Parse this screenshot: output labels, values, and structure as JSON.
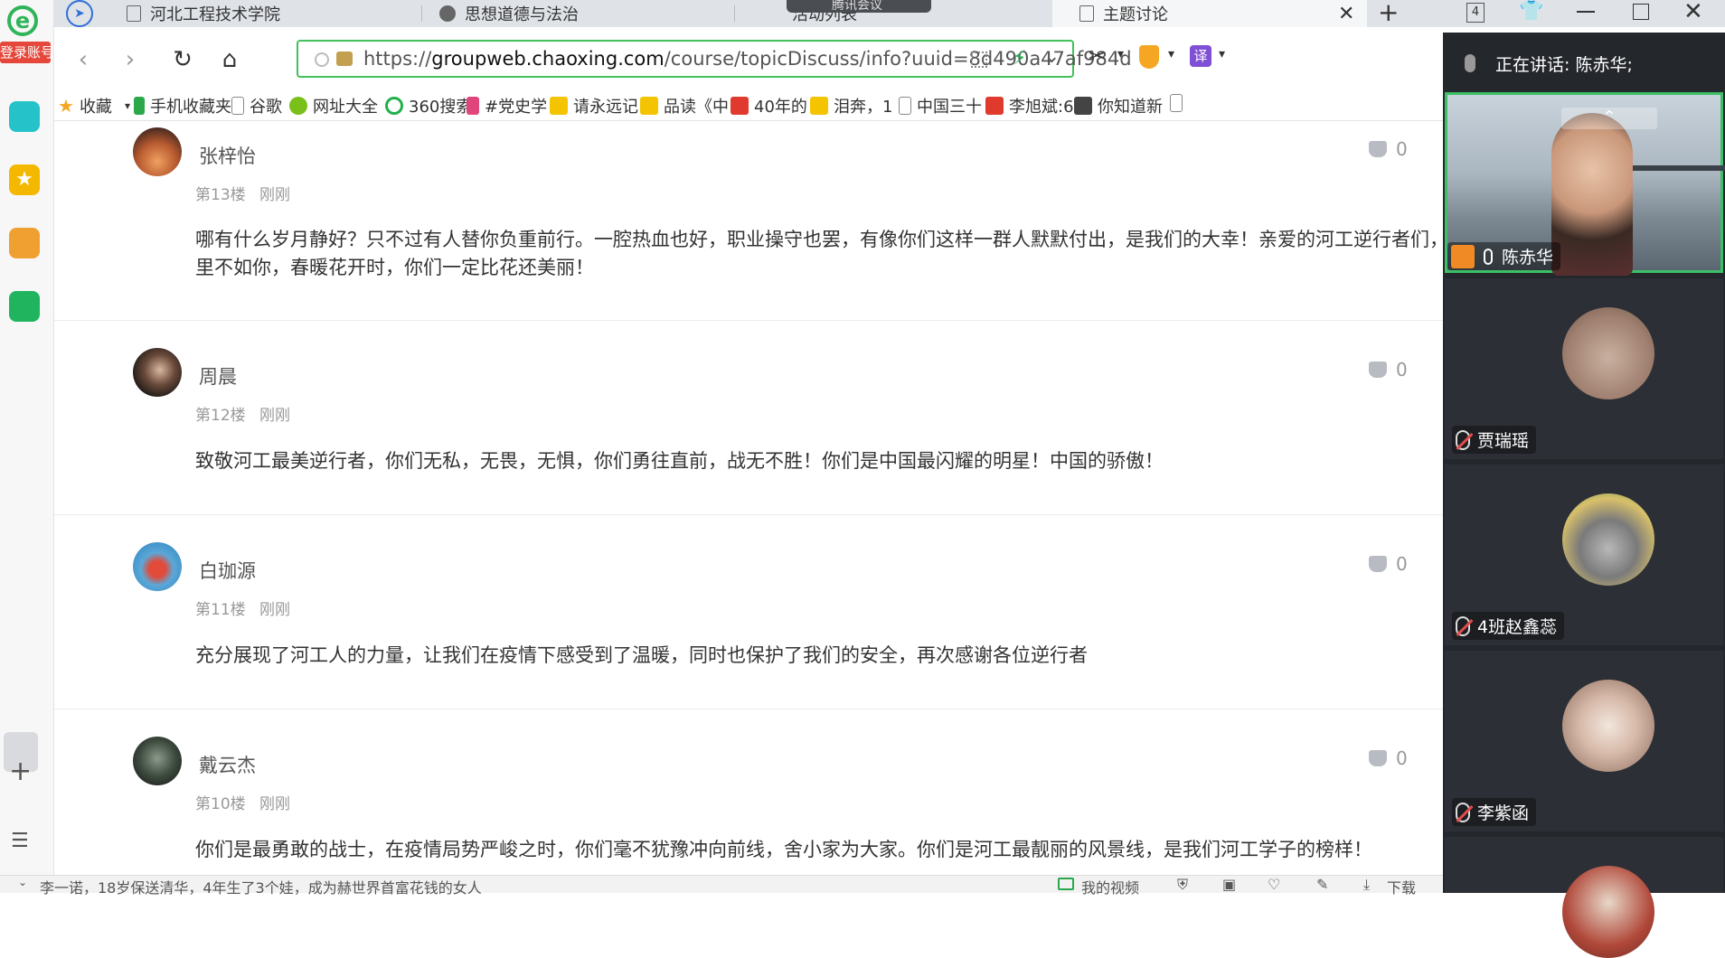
{
  "tabs": [
    {
      "label": "河北工程技术学院"
    },
    {
      "label": "思想道德与法治"
    },
    {
      "label": "活动列表"
    },
    {
      "label": "主题讨论"
    }
  ],
  "meeting_overlay_label": "腾讯会议",
  "tab_count": "4",
  "address": {
    "scheme": "https://",
    "host": "groupweb.chaoxing.com",
    "path": "/course/topicDiscuss/info?uuid=8d490a47af984d"
  },
  "bookmarks": [
    {
      "label": "收藏",
      "color": "#f5a623"
    },
    {
      "label": "手机收藏夹",
      "color": "#2aa84a"
    },
    {
      "label": "谷歌",
      "color": "#888888"
    },
    {
      "label": "网址大全",
      "color": "#7bbf1a"
    },
    {
      "label": "360搜索",
      "color": "#21b04b"
    },
    {
      "label": "#党史学",
      "color": "#e0457b"
    },
    {
      "label": "请永远记",
      "color": "#f5c400"
    },
    {
      "label": "品读《中",
      "color": "#f5c400"
    },
    {
      "label": "40年的",
      "color": "#e03a2e"
    },
    {
      "label": "泪奔，1",
      "color": "#f5c400"
    },
    {
      "label": "中国三十",
      "color": "#888888"
    },
    {
      "label": "李旭斌:6",
      "color": "#e03a2e"
    },
    {
      "label": "你知道新",
      "color": "#444444"
    }
  ],
  "sidebar": {
    "login_label": "登录账号"
  },
  "posts": [
    {
      "name": "张梓怡",
      "floor": "第13楼",
      "time": "刚刚",
      "likes": "0",
      "text": "哪有什么岁月静好？只不过有人替你负重前行。一腔热血也好，职业操守也罢，有像你们这样一群人默默付出，是我们的大幸！亲爱的河工逆行者们，",
      "text2": "里不如你，春暖花开时，你们一定比花还美丽！"
    },
    {
      "name": "周晨",
      "floor": "第12楼",
      "time": "刚刚",
      "likes": "0",
      "text": "致敬河工最美逆行者，你们无私，无畏，无惧，你们勇往直前，战无不胜！你们是中国最闪耀的明星！中国的骄傲！"
    },
    {
      "name": "白珈源",
      "floor": "第11楼",
      "time": "刚刚",
      "likes": "0",
      "text": "充分展现了河工人的力量，让我们在疫情下感受到了温暖，同时也保护了我们的安全，再次感谢各位逆行者"
    },
    {
      "name": "戴云杰",
      "floor": "第10楼",
      "time": "刚刚",
      "likes": "0",
      "text": "你们是最勇敢的战士，在疫情局势严峻之时，你们毫不犹豫冲向前线，舍小家为大家。你们是河工最靓丽的风景线，是我们河工学子的榜样！"
    }
  ],
  "meeting": {
    "speaking": "正在讲话: 陈赤华;",
    "participants": [
      {
        "name": "陈赤华"
      },
      {
        "name": "贾瑞瑶"
      },
      {
        "name": "4班赵鑫蕊"
      },
      {
        "name": "李紫函"
      }
    ]
  },
  "statusbar": {
    "news": "李一诺，18岁保送清华，4年生了3个娃，成为赫世界首富花钱的女人",
    "video": "我的视频",
    "download": "下载"
  }
}
